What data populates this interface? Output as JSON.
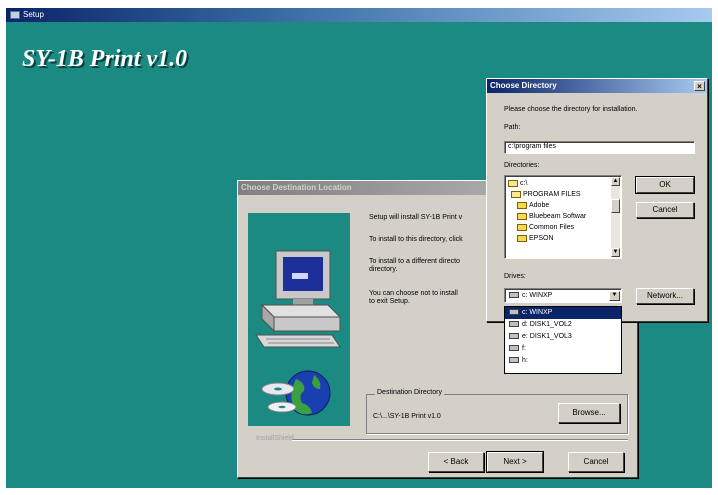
{
  "setup": {
    "window_title": "Setup",
    "app_title": "SY-1B Print v1.0"
  },
  "destination_dialog": {
    "title": "Choose Destination Location",
    "lines": [
      "Setup will install SY-1B Print v",
      "To install to this directory, click",
      "To install to a different directo",
      "directory.",
      "You can choose not to install",
      "to exit Setup."
    ],
    "group_label": "Destination Directory",
    "destination_path": "C:\\...\\SY-1B Print v1.0",
    "browse_label": "Browse...",
    "installshield_label": "InstallShield",
    "back_label": "< Back",
    "next_label": "Next >",
    "cancel_label": "Cancel"
  },
  "choose_dialog": {
    "title": "Choose Directory",
    "close_label": "×",
    "instruction": "Please choose the directory for installation.",
    "path_label": "Path:",
    "path_value": "c:\\program files",
    "directories_label": "Directories:",
    "directories": [
      "c:\\",
      "PROGRAM FILES",
      "Adobe",
      "Bluebeam Softwar",
      "Common Files",
      "EPSON"
    ],
    "drives_label": "Drives:",
    "selected_drive": "c: WINXP",
    "drive_options": [
      "c: WINXP",
      "d: DISK1_VOL2",
      "e: DISK1_VOL3",
      "f:",
      "h:"
    ],
    "ok_label": "OK",
    "cancel_label": "Cancel",
    "network_label": "Network..."
  },
  "icons": {
    "scroll_up": "▲",
    "scroll_down": "▼",
    "dropdown_arrow": "▼"
  }
}
